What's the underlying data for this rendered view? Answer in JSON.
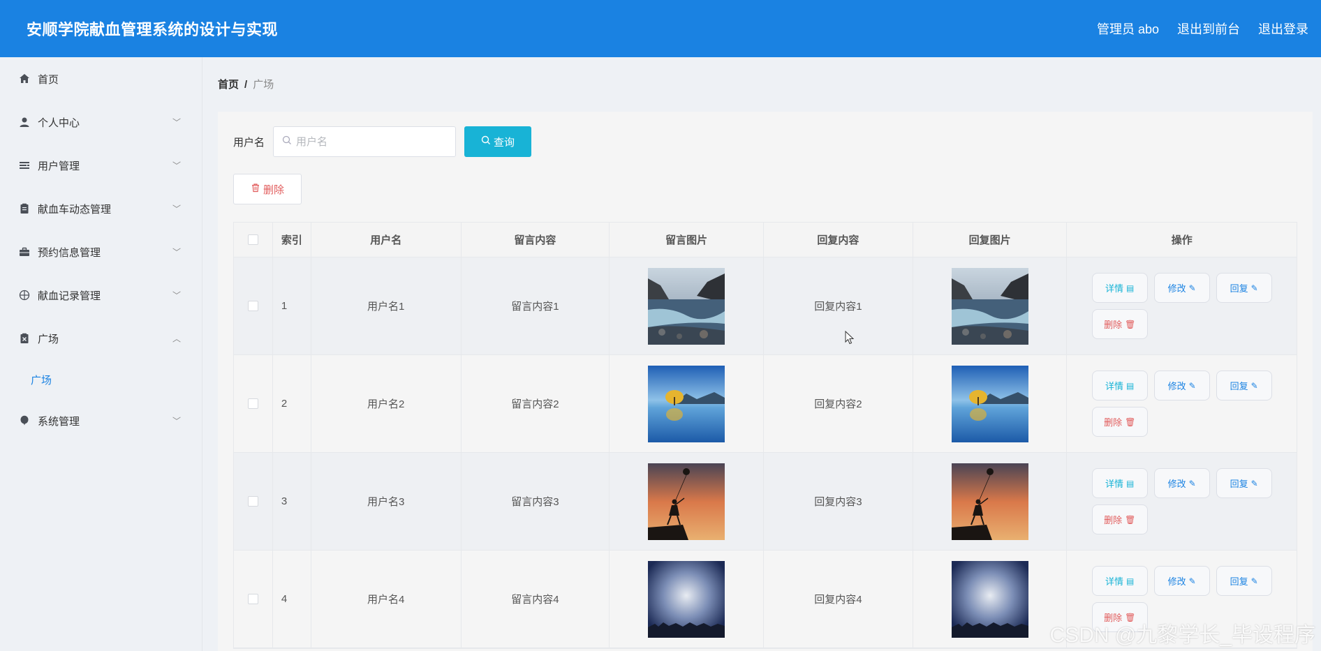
{
  "header": {
    "title": "安顺学院献血管理系统的设计与实现",
    "admin": "管理员 abo",
    "front": "退出到前台",
    "logout": "退出登录"
  },
  "sidebar": {
    "items": [
      {
        "label": "首页",
        "icon": "home-icon",
        "chevron": false
      },
      {
        "label": "个人中心",
        "icon": "user-icon",
        "chevron": "down"
      },
      {
        "label": "用户管理",
        "icon": "list-icon",
        "chevron": "down"
      },
      {
        "label": "献血车动态管理",
        "icon": "clipboard-icon",
        "chevron": "down"
      },
      {
        "label": "预约信息管理",
        "icon": "briefcase-icon",
        "chevron": "down"
      },
      {
        "label": "献血记录管理",
        "icon": "target-icon",
        "chevron": "down"
      },
      {
        "label": "广场",
        "icon": "clipboard-x-icon",
        "chevron": "up"
      },
      {
        "label": "系统管理",
        "icon": "balloon-icon",
        "chevron": "down"
      }
    ],
    "sub_active": "广场"
  },
  "breadcrumb": {
    "home": "首页",
    "sep": "/",
    "current": "广场"
  },
  "search": {
    "label": "用户名",
    "placeholder": "用户名",
    "value": "",
    "button": "查询"
  },
  "toolbar": {
    "delete": "删除"
  },
  "table": {
    "columns": [
      "索引",
      "用户名",
      "留言内容",
      "留言图片",
      "回复内容",
      "回复图片",
      "操作"
    ],
    "rows": [
      {
        "index": "1",
        "user": "用户名1",
        "message": "留言内容1",
        "reply": "回复内容1",
        "image": "river-landscape"
      },
      {
        "index": "2",
        "user": "用户名2",
        "message": "留言内容2",
        "reply": "回复内容2",
        "image": "lake-tree"
      },
      {
        "index": "3",
        "user": "用户名3",
        "message": "留言内容3",
        "reply": "回复内容3",
        "image": "girl-balloon-sunset"
      },
      {
        "index": "4",
        "user": "用户名4",
        "message": "留言内容4",
        "reply": "回复内容4",
        "image": "night-sky-crowd"
      }
    ],
    "actions": {
      "detail": "详情",
      "edit": "修改",
      "reply": "回复",
      "delete": "删除"
    }
  },
  "watermark": "CSDN @九黎学长_毕设程序",
  "colors": {
    "header": "#1a82e2",
    "query": "#18b3d6",
    "danger": "#e15b5b",
    "active": "#1a82e2"
  }
}
